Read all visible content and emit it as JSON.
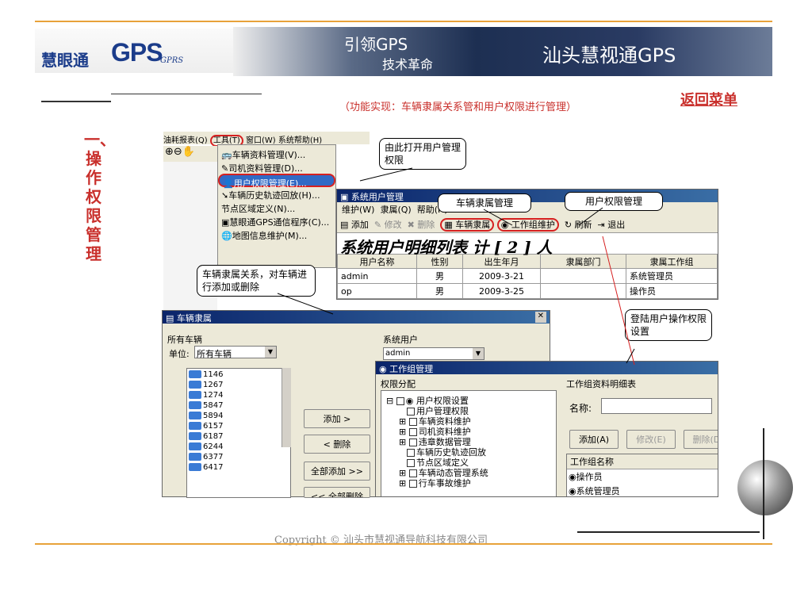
{
  "header": {
    "logo_text": "慧眼通",
    "logo_gps": "GPS",
    "logo_gprs": "GPRS",
    "slogan_line1": "引领GPS",
    "slogan_line2": "技术革命",
    "title": "汕头慧视通GPS"
  },
  "top_note": "（功能实现：车辆隶属关系管和用户权限进行管理）",
  "back_menu": "返回菜单",
  "section_title": "一、操作权限管理",
  "menubar": [
    "油耗报表(Q)",
    "工具(T)",
    "窗口(W)",
    "系统帮助(H)"
  ],
  "tools_menu": {
    "items": [
      "车辆资料管理(V)...",
      "司机资料管理(D)...",
      "用户权限管理(E)...",
      "车辆历史轨迹回放(H)...",
      "节点区域定义(N)...",
      "慧眼通GPS通信程序(C)...",
      "地图信息维护(M)..."
    ]
  },
  "callouts": {
    "open_user": "由此打开用户管理权限",
    "vehicle_affil": "车辆隶属管理",
    "user_perm": "用户权限管理",
    "vehicle_rel": "车辆隶属关系，对车辆进行添加或删除",
    "login_perm": "登陆用户操作权限设置"
  },
  "user_mgmt": {
    "title": "系统用户管理",
    "menu": [
      "维护(W)",
      "隶属(Q)",
      "帮助(H)"
    ],
    "toolbar": [
      "添加",
      "修改",
      "删除",
      "车辆隶属",
      "工作组维护",
      "刷新",
      "退出"
    ],
    "list_title": "系统用户明细列表  计 [ 2 ] 人",
    "columns": [
      "用户名称",
      "性别",
      "出生年月",
      "隶属部门",
      "隶属工作组"
    ],
    "rows": [
      [
        "admin",
        "男",
        "2009-3-21",
        "",
        "系统管理员"
      ],
      [
        "op",
        "男",
        "2009-3-25",
        "",
        "操作员"
      ]
    ]
  },
  "vehicle_affil": {
    "title": "车辆隶属",
    "all_vehicles": "所有车辆",
    "unit_label": "单位:",
    "unit_value": "所有车辆",
    "vehicles": [
      "1146",
      "1267",
      "1274",
      "5847",
      "5894",
      "6157",
      "6187",
      "6244",
      "6377",
      "6417"
    ],
    "system_user": "系统用户",
    "user_value": "admin",
    "btn_add": "添加 >",
    "btn_remove": "< 删除",
    "btn_add_all": "全部添加 >>",
    "btn_remove_all": "<< 全部删除"
  },
  "workgroup": {
    "title": "工作组管理",
    "perm_label": "权限分配",
    "tree": [
      "用户权限设置",
      "用户管理权限",
      "车辆资料维护",
      "司机资料维护",
      "违章数据管理",
      "车辆历史轨迹回放",
      "节点区域定义",
      "车辆动态管理系统",
      "行车事故维护"
    ],
    "detail_label": "工作组资料明细表",
    "name_label": "名称:",
    "btn_add": "添加(A)",
    "btn_edit": "修改(E)",
    "btn_delete": "删除(D)",
    "list_header": "工作组名称",
    "groups": [
      "操作员",
      "系统管理员"
    ]
  },
  "copyright": "Copyright © 汕头市慧视通导航科技有限公司"
}
